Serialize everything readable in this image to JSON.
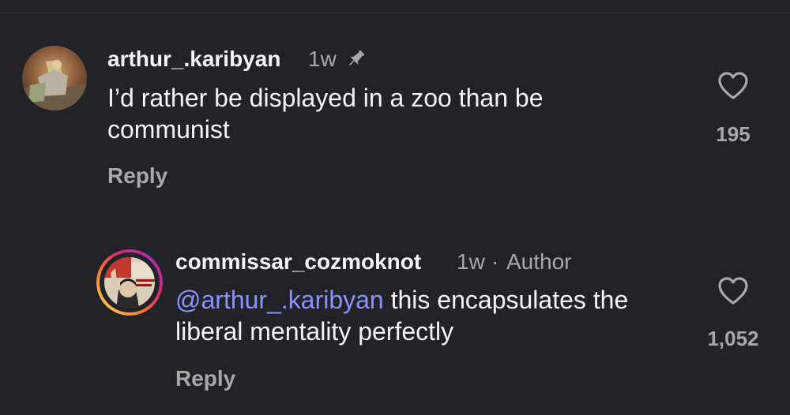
{
  "comments": [
    {
      "username": "arthur_.karibyan",
      "time": "1w",
      "author_tag": "",
      "text": "I’d rather be displayed in a zoo than be communist",
      "mention": "",
      "reply_label": "Reply",
      "likes": "195",
      "pinned": true
    },
    {
      "username": "commissar_cozmoknot",
      "time": "1w",
      "author_separator": "·",
      "author_tag": "Author",
      "mention": "@arthur_.karibyan",
      "text": "this encapsulates the liberal mentality perfectly",
      "reply_label": "Reply",
      "likes": "1,052",
      "pinned": false
    }
  ],
  "colors": {
    "background": "#212328",
    "primary_text": "#f5f5f5",
    "secondary_text": "#a8a8a8",
    "mention": "#8c92ff"
  }
}
